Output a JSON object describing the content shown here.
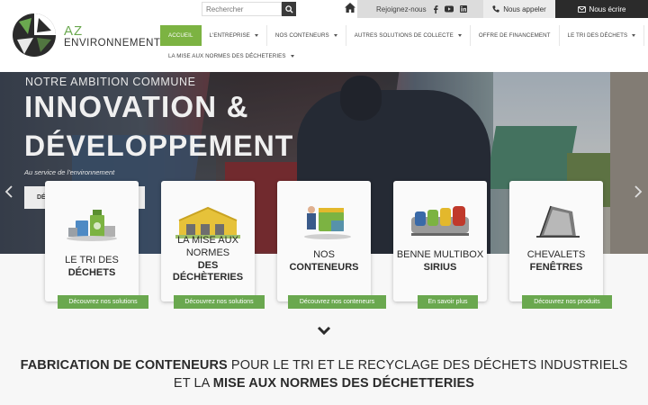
{
  "brand": {
    "line1": "AZ",
    "line2": "ENVIRONNEMENT"
  },
  "search": {
    "placeholder": "Rechercher"
  },
  "topbar": {
    "join_label": "Rejoignez-nous",
    "call_label": "Nous appeler",
    "mail_label": "Nous écrire"
  },
  "nav": {
    "items": [
      {
        "label": "ACCUEIL"
      },
      {
        "label": "L'ENTREPRISE"
      },
      {
        "label": "NOS CONTENEURS"
      },
      {
        "label": "AUTRES SOLUTIONS DE COLLECTE"
      },
      {
        "label": "OFFRE DE FINANCEMENT"
      },
      {
        "label": "LE TRI DES DÉCHETS"
      },
      {
        "label": "LA MISE AUX NORMES DES DÉCHETERIES"
      }
    ]
  },
  "hero": {
    "eyebrow": "NOTRE AMBITION COMMUNE",
    "title_line1": "INNOVATION &",
    "title_line2": "DÉVELOPPEMENT",
    "subtitle": "Au service de l'environnement",
    "button_label": "DÉ"
  },
  "cards": [
    {
      "line1": "LE TRI DES",
      "line2": "DÉCHETS",
      "button": "Découvrez nos solutions"
    },
    {
      "line1": "LA MISE AUX",
      "line1b": "NORMES",
      "line2": "DES",
      "line2b": "DÉCHÈTERIES",
      "button": "Découvrez nos solutions"
    },
    {
      "line1": "NOS",
      "line2": "CONTENEURS",
      "button": "Découvrez nos conteneurs"
    },
    {
      "line1": "BENNE MULTIBOX",
      "line2": "SIRIUS",
      "button": "En savoir plus"
    },
    {
      "line1": "CHEVALETS",
      "line2": "FENÊTRES",
      "button": "Découvrez nos produits"
    }
  ],
  "tagline": {
    "bold1": "FABRICATION DE CONTENEURS",
    "normal1": " POUR LE TRI ET LE RECYCLAGE DES DÉCHETS INDUSTRIELS",
    "normal2": "ET LA ",
    "bold2": "MISE AUX NORMES DES DÉCHETTERIES"
  },
  "colors": {
    "accent": "#6aa84f",
    "dark": "#2b2b2b",
    "topbar_grey": "#dcdcdc"
  },
  "icons": [
    "search-icon",
    "home-icon",
    "facebook-icon",
    "youtube-icon",
    "linkedin-icon",
    "phone-icon",
    "mail-icon",
    "chevron-left-icon",
    "chevron-right-icon",
    "chevron-down-icon"
  ]
}
